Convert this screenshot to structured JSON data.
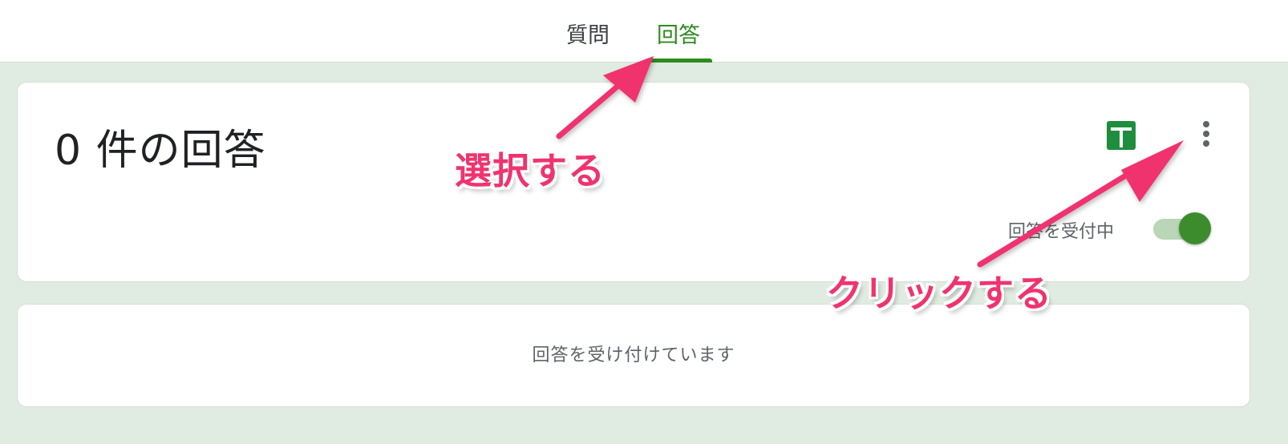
{
  "tabs": [
    {
      "label": "質問",
      "active": false
    },
    {
      "label": "回答",
      "active": true
    }
  ],
  "summary": {
    "title": "0 件の回答",
    "sheets_icon": "google-sheets-icon",
    "more_icon": "more-vert-icon",
    "accepting_label": "回答を受付中",
    "accepting_on": true
  },
  "accepting_card": {
    "message": "回答を受け付けています"
  },
  "annotations": {
    "select_label": "選択する",
    "click_label": "クリックする"
  },
  "colors": {
    "accent": "#2e8a1f",
    "background": "#e0ece1",
    "annotation": "#f0336e"
  }
}
